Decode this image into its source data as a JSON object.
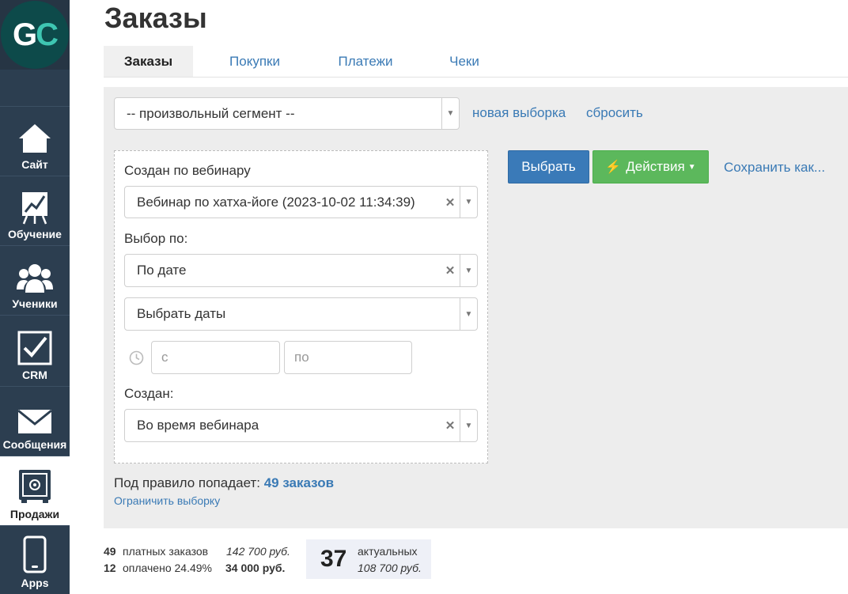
{
  "sidebar": {
    "logo_g": "G",
    "logo_c": "C",
    "items": [
      {
        "label": "Сайт",
        "icon": "house-icon"
      },
      {
        "label": "Обучение",
        "icon": "chart-board-icon"
      },
      {
        "label": "Ученики",
        "icon": "users-icon"
      },
      {
        "label": "CRM",
        "icon": "checkbox-icon"
      },
      {
        "label": "Сообщения",
        "icon": "envelope-icon"
      },
      {
        "label": "Продажи",
        "icon": "safe-icon"
      },
      {
        "label": "Apps",
        "icon": "phone-icon"
      }
    ]
  },
  "page": {
    "title": "Заказы"
  },
  "tabs": [
    {
      "label": "Заказы",
      "active": true
    },
    {
      "label": "Покупки",
      "active": false
    },
    {
      "label": "Платежи",
      "active": false
    },
    {
      "label": "Чеки",
      "active": false
    }
  ],
  "filter": {
    "segment_value": "-- произвольный сегмент --",
    "new_selection": "новая выборка",
    "reset": "сбросить",
    "webinar_label": "Создан по вебинару",
    "webinar_value": "Вебинар по хатха-йоге (2023-10-02 11:34:39)",
    "selection_by_label": "Выбор по:",
    "selection_by_value": "По дате",
    "dates_value": "Выбрать даты",
    "date_from_placeholder": "с",
    "date_to_placeholder": "по",
    "created_label": "Создан:",
    "created_value": "Во время вебинара",
    "rule_text": "Под правило попадает:",
    "rule_count": "49 заказов",
    "limit_link": "Ограничить выборку"
  },
  "actions": {
    "select": "Выбрать",
    "actions": "Действия",
    "save_as": "Сохранить как..."
  },
  "stats": {
    "paid_count": "49",
    "paid_label": "платных заказов",
    "paid_sum": "142 700 руб.",
    "paid2_count": "12",
    "paid2_label": "оплачено 24.49%",
    "paid2_sum": "34 000 руб.",
    "actual_count": "37",
    "actual_label": "актуальных",
    "actual_sum": "108 700 руб."
  },
  "colors": {
    "sidebar": "#2c3e50",
    "link": "#3a7ab5",
    "primary": "#3a7ab8",
    "success": "#5cb85c",
    "logo_accent": "#3ec6b2"
  }
}
